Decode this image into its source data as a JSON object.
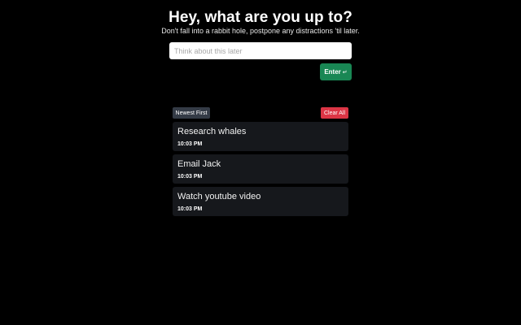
{
  "header": {
    "title": "Hey, what are you up to?",
    "subtitle": "Don't fall into a rabbit hole, postpone any distractions 'til later."
  },
  "input": {
    "value": "",
    "placeholder": "Think about this later"
  },
  "enter_button": {
    "label": "Enter",
    "icon": "↵",
    "icon_name": "return-icon",
    "color": "#198754"
  },
  "controls": {
    "sort_label": "Newest First",
    "sort_color": "#343b46",
    "clear_label": "Clear All",
    "clear_color": "#dc3545"
  },
  "items": [
    {
      "title": "Research whales",
      "time": "10:03 PM"
    },
    {
      "title": "Email Jack",
      "time": "10:03 PM"
    },
    {
      "title": "Watch youtube video",
      "time": "10:03 PM"
    }
  ]
}
